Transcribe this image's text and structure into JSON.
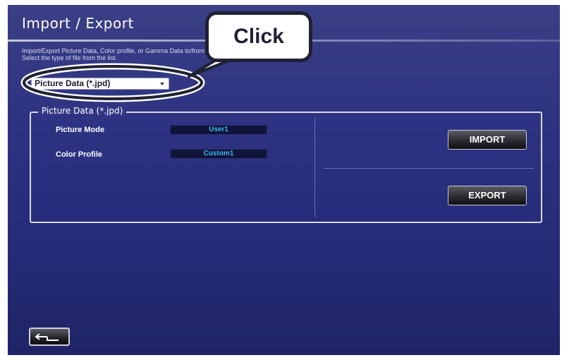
{
  "window": {
    "title": "Import / Export",
    "description_lines": [
      "Import/Export Picture Data, Color profile, or Gamma Data to/from the projector.",
      "Select the type of file from the list."
    ]
  },
  "file_type_select": {
    "selected": "Picture Data (*.jpd)"
  },
  "group": {
    "title": "Picture Data (*.jpd)",
    "rows": [
      {
        "label": "Picture Mode",
        "value": "User1"
      },
      {
        "label": "Color Profile",
        "value": "Custom1"
      }
    ]
  },
  "buttons": {
    "import": "IMPORT",
    "export": "EXPORT"
  },
  "back_button": {
    "icon": "return-arrow-icon"
  },
  "callout": {
    "text": "Click"
  },
  "colors": {
    "value_text": "#3fb9e8",
    "background": "#2d3282"
  }
}
